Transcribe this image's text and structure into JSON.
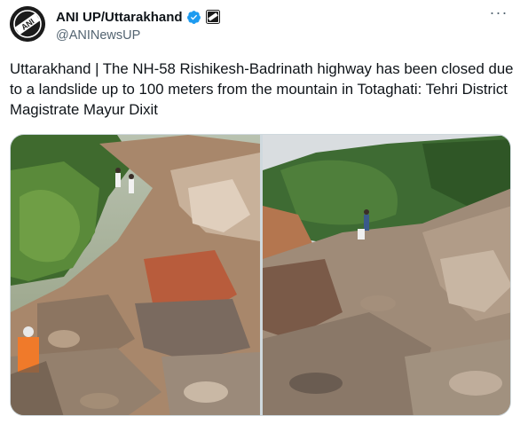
{
  "account": {
    "display_name": "ANI UP/Uttarakhand",
    "handle": "@ANINewsUP",
    "avatar_logo_text": "ANI"
  },
  "icons": {
    "verified": "verified-badge-icon",
    "affiliate": "affiliate-badge-icon",
    "more": "more-options-icon"
  },
  "tweet": {
    "text": "Uttarakhand | The NH-58 Rishikesh-Badrinath highway has been closed due to a landslide up to 100 meters from the mountain in Totaghati: Tehri District Magistrate Mayur Dixit"
  },
  "media": {
    "count": 2
  },
  "colors": {
    "verified_blue": "#1d9bf0",
    "secondary_text": "#536471",
    "primary_text": "#0f1419"
  }
}
